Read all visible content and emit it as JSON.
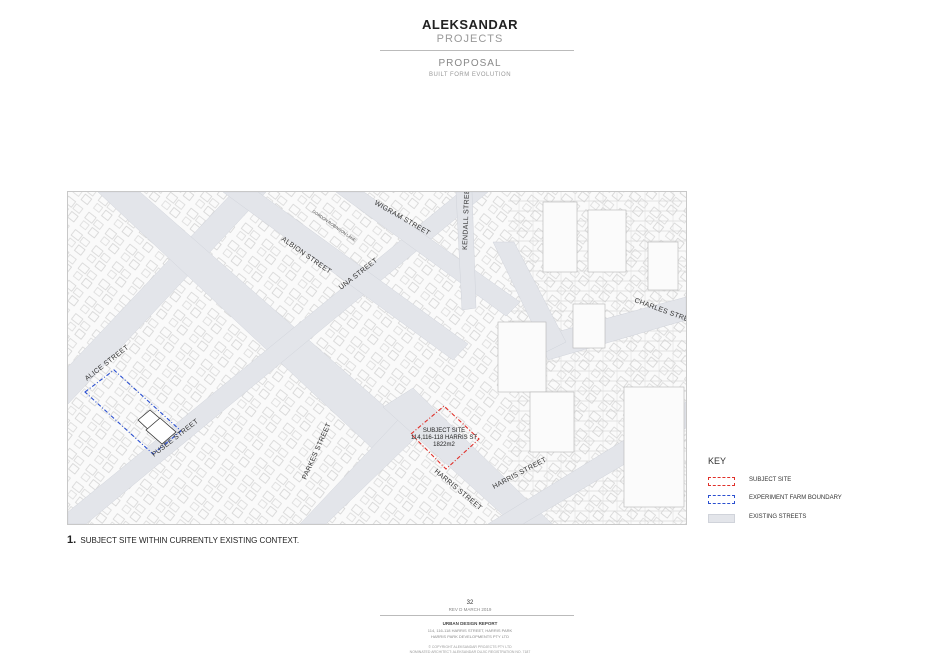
{
  "header": {
    "brand_title": "ALEKSANDAR",
    "brand_subtitle": "PROJECTS",
    "section": "PROPOSAL",
    "subsection": "BUILT FORM EVOLUTION"
  },
  "map": {
    "streets": {
      "wigram": "WIGRAM STREET",
      "kendall": "KENDALL STREET",
      "albion": "ALBION STREET",
      "una": "UNA STREET",
      "charles": "CHARLES STREET",
      "alice": "ALICE STREET",
      "pusee": "PUSEE STREET",
      "parkes": "PARKES STREET",
      "harris_sw": "HARRIS STREET",
      "harris_ne": "HARRIS STREET",
      "lane": "GORDON ROBINSON LANE"
    },
    "site_label": {
      "line1": "SUBJECT SITE",
      "line2": "114,116-118 HARRIS ST",
      "line3": "1822m2"
    },
    "colors": {
      "street_fill": "#e3e5ea",
      "block_fill": "#fafafa",
      "building_line": "#b8b8b8",
      "subject_site": "#e0302a",
      "farm_boundary": "#2a4fd0"
    }
  },
  "caption": {
    "number": "1.",
    "text": "SUBJECT SITE WITHIN CURRENTLY EXISTING CONTEXT."
  },
  "key": {
    "title": "KEY",
    "items": [
      {
        "label": "SUBJECT SITE",
        "color": "#e0302a",
        "style": "dashed"
      },
      {
        "label": "EXPERIMENT FARM BOUNDARY",
        "color": "#2a4fd0",
        "style": "dashed"
      },
      {
        "label": "EXISTING STREETS",
        "color": "#e3e5ea",
        "style": "fill"
      }
    ]
  },
  "footer": {
    "page_number": "32",
    "revision": "REV D  MARCH 2019",
    "report_title": "URBAN DESIGN REPORT",
    "line1": "114, 116-118 HARRIS STREET, HARRIS PARK",
    "line2": "HARRIS PARK DEVELOPMENTS PTY LTD",
    "copyright": "© COPYRIGHT ALEKSANDAR PROJECTS PTY LTD",
    "nominated": "NOMINATED ARCHITECT: ALEKSANDAR DUJIC  REGISTRATION NO. 7187"
  }
}
